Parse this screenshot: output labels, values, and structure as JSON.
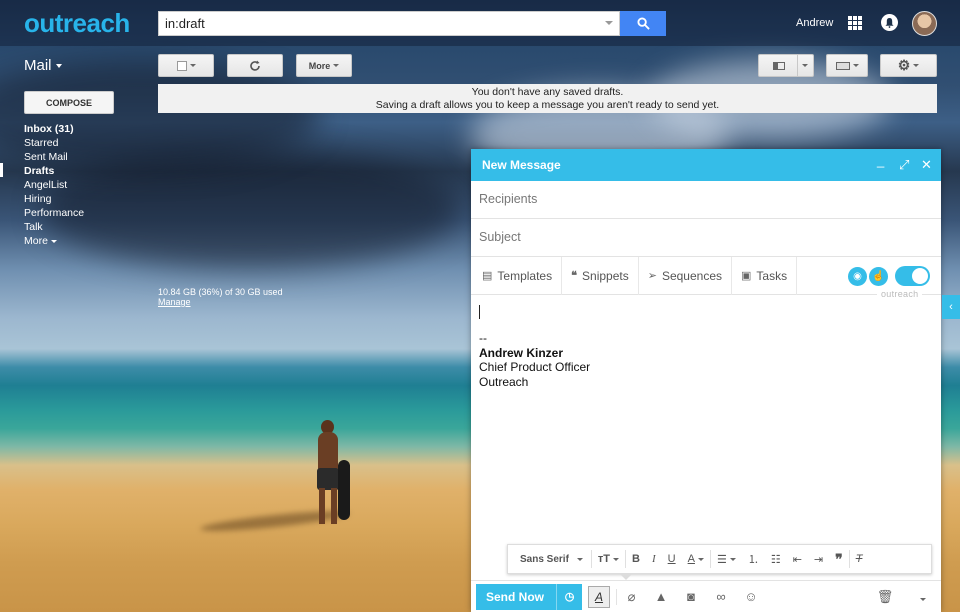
{
  "topbar": {
    "logo": "outreach",
    "search_value": "in:draft",
    "username": "Andrew"
  },
  "toolbar": {
    "mail_label": "Mail",
    "more_label": "More"
  },
  "notice": {
    "line1": "You don't have any saved drafts.",
    "line2": "Saving a draft allows you to keep a message you aren't ready to send yet."
  },
  "sidebar": {
    "compose_label": "COMPOSE",
    "items": [
      {
        "label": "Inbox (31)"
      },
      {
        "label": "Starred"
      },
      {
        "label": "Sent Mail"
      },
      {
        "label": "Drafts"
      },
      {
        "label": "AngelList"
      },
      {
        "label": "Hiring"
      },
      {
        "label": "Performance"
      },
      {
        "label": "Talk"
      },
      {
        "label": "More"
      }
    ],
    "storage_text": "10.84 GB (36%) of 30 GB used",
    "manage_link": "Manage"
  },
  "composer": {
    "title": "New Message",
    "recipients_placeholder": "Recipients",
    "subject_placeholder": "Subject",
    "tools": [
      {
        "label": "Templates"
      },
      {
        "label": "Snippets"
      },
      {
        "label": "Sequences"
      },
      {
        "label": "Tasks"
      }
    ],
    "brand_tag": "outreach",
    "signature": {
      "separator": "--",
      "name": "Andrew Kinzer",
      "title": "Chief Product Officer",
      "company": "Outreach"
    },
    "format": {
      "font": "Sans Serif"
    },
    "send_label": "Send Now"
  },
  "colors": {
    "accent": "#35bde8",
    "search_button": "#4285f4",
    "logo": "#28b4ea"
  }
}
